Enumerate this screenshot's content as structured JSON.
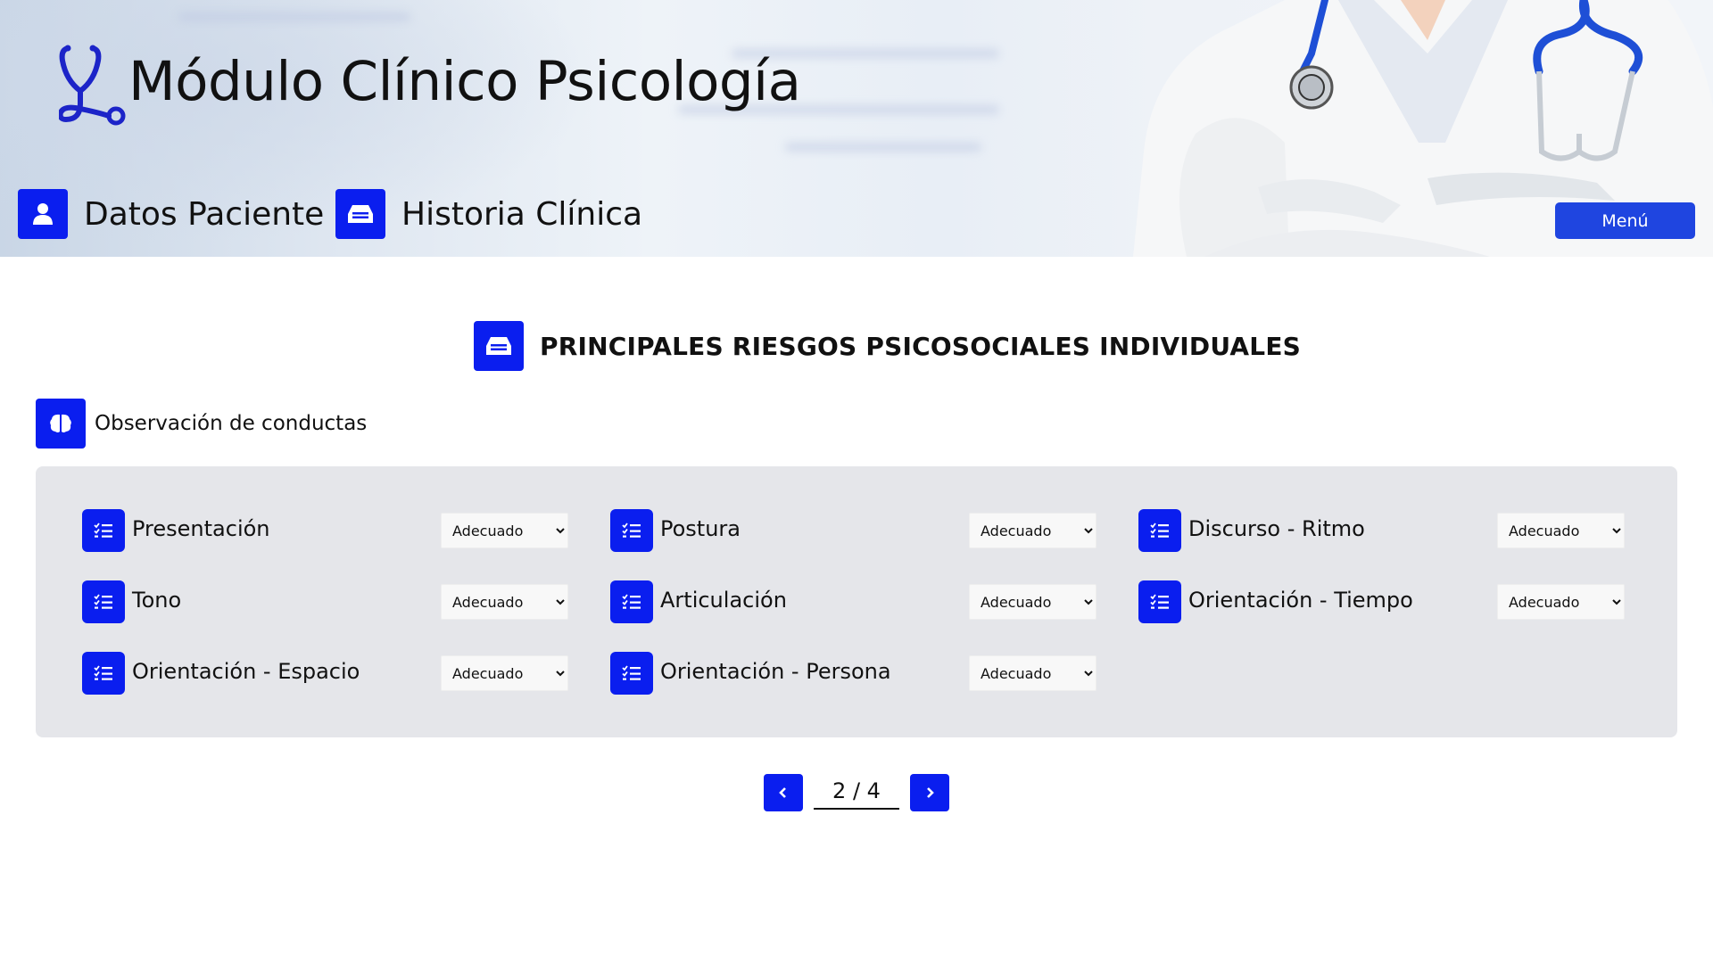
{
  "header": {
    "app_title": "Módulo Clínico Psicología",
    "nav": [
      {
        "label": "Datos Paciente",
        "icon": "user-icon"
      },
      {
        "label": "Historia Clínica",
        "icon": "inbox-icon"
      }
    ],
    "menu_label": "Menú"
  },
  "section": {
    "title": "PRINCIPALES RIESGOS PSICOSOCIALES INDIVIDUALES",
    "title_icon": "inbox-icon",
    "subtitle": "Observación de conductas",
    "subtitle_icon": "brain-icon"
  },
  "fields": [
    {
      "label": "Presentación",
      "value": "Adecuado",
      "icon": "list-check-icon"
    },
    {
      "label": "Postura",
      "value": "Adecuado",
      "icon": "list-check-icon"
    },
    {
      "label": "Discurso - Ritmo",
      "value": "Adecuado",
      "icon": "list-check-icon"
    },
    {
      "label": "Tono",
      "value": "Adecuado",
      "icon": "list-check-icon"
    },
    {
      "label": "Articulación",
      "value": "Adecuado",
      "icon": "list-check-icon"
    },
    {
      "label": "Orientación - Tiempo",
      "value": "Adecuado",
      "icon": "list-check-icon"
    },
    {
      "label": "Orientación - Espacio",
      "value": "Adecuado",
      "icon": "list-check-icon"
    },
    {
      "label": "Orientación - Persona",
      "value": "Adecuado",
      "icon": "list-check-icon"
    }
  ],
  "pagination": {
    "current": "2 / 4"
  },
  "colors": {
    "accent": "#0a1eef",
    "menu_button": "#1f45e0",
    "panel": "#e5e6ea"
  }
}
